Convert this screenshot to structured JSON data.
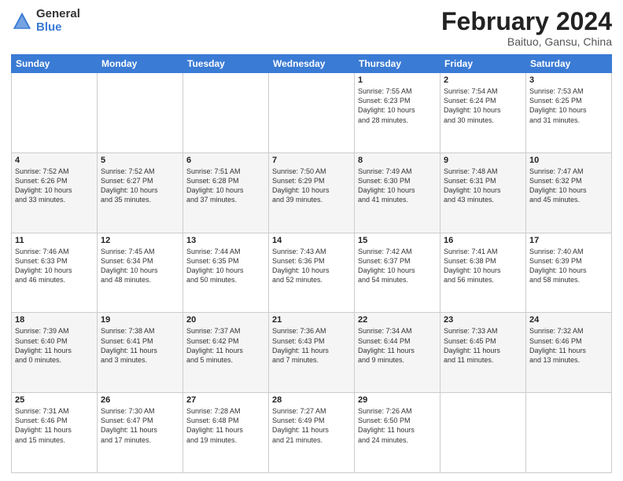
{
  "header": {
    "logo_general": "General",
    "logo_blue": "Blue",
    "title": "February 2024",
    "location": "Baituo, Gansu, China"
  },
  "days_of_week": [
    "Sunday",
    "Monday",
    "Tuesday",
    "Wednesday",
    "Thursday",
    "Friday",
    "Saturday"
  ],
  "weeks": [
    [
      {
        "day": "",
        "info": ""
      },
      {
        "day": "",
        "info": ""
      },
      {
        "day": "",
        "info": ""
      },
      {
        "day": "",
        "info": ""
      },
      {
        "day": "1",
        "info": "Sunrise: 7:55 AM\nSunset: 6:23 PM\nDaylight: 10 hours\nand 28 minutes."
      },
      {
        "day": "2",
        "info": "Sunrise: 7:54 AM\nSunset: 6:24 PM\nDaylight: 10 hours\nand 30 minutes."
      },
      {
        "day": "3",
        "info": "Sunrise: 7:53 AM\nSunset: 6:25 PM\nDaylight: 10 hours\nand 31 minutes."
      }
    ],
    [
      {
        "day": "4",
        "info": "Sunrise: 7:52 AM\nSunset: 6:26 PM\nDaylight: 10 hours\nand 33 minutes."
      },
      {
        "day": "5",
        "info": "Sunrise: 7:52 AM\nSunset: 6:27 PM\nDaylight: 10 hours\nand 35 minutes."
      },
      {
        "day": "6",
        "info": "Sunrise: 7:51 AM\nSunset: 6:28 PM\nDaylight: 10 hours\nand 37 minutes."
      },
      {
        "day": "7",
        "info": "Sunrise: 7:50 AM\nSunset: 6:29 PM\nDaylight: 10 hours\nand 39 minutes."
      },
      {
        "day": "8",
        "info": "Sunrise: 7:49 AM\nSunset: 6:30 PM\nDaylight: 10 hours\nand 41 minutes."
      },
      {
        "day": "9",
        "info": "Sunrise: 7:48 AM\nSunset: 6:31 PM\nDaylight: 10 hours\nand 43 minutes."
      },
      {
        "day": "10",
        "info": "Sunrise: 7:47 AM\nSunset: 6:32 PM\nDaylight: 10 hours\nand 45 minutes."
      }
    ],
    [
      {
        "day": "11",
        "info": "Sunrise: 7:46 AM\nSunset: 6:33 PM\nDaylight: 10 hours\nand 46 minutes."
      },
      {
        "day": "12",
        "info": "Sunrise: 7:45 AM\nSunset: 6:34 PM\nDaylight: 10 hours\nand 48 minutes."
      },
      {
        "day": "13",
        "info": "Sunrise: 7:44 AM\nSunset: 6:35 PM\nDaylight: 10 hours\nand 50 minutes."
      },
      {
        "day": "14",
        "info": "Sunrise: 7:43 AM\nSunset: 6:36 PM\nDaylight: 10 hours\nand 52 minutes."
      },
      {
        "day": "15",
        "info": "Sunrise: 7:42 AM\nSunset: 6:37 PM\nDaylight: 10 hours\nand 54 minutes."
      },
      {
        "day": "16",
        "info": "Sunrise: 7:41 AM\nSunset: 6:38 PM\nDaylight: 10 hours\nand 56 minutes."
      },
      {
        "day": "17",
        "info": "Sunrise: 7:40 AM\nSunset: 6:39 PM\nDaylight: 10 hours\nand 58 minutes."
      }
    ],
    [
      {
        "day": "18",
        "info": "Sunrise: 7:39 AM\nSunset: 6:40 PM\nDaylight: 11 hours\nand 0 minutes."
      },
      {
        "day": "19",
        "info": "Sunrise: 7:38 AM\nSunset: 6:41 PM\nDaylight: 11 hours\nand 3 minutes."
      },
      {
        "day": "20",
        "info": "Sunrise: 7:37 AM\nSunset: 6:42 PM\nDaylight: 11 hours\nand 5 minutes."
      },
      {
        "day": "21",
        "info": "Sunrise: 7:36 AM\nSunset: 6:43 PM\nDaylight: 11 hours\nand 7 minutes."
      },
      {
        "day": "22",
        "info": "Sunrise: 7:34 AM\nSunset: 6:44 PM\nDaylight: 11 hours\nand 9 minutes."
      },
      {
        "day": "23",
        "info": "Sunrise: 7:33 AM\nSunset: 6:45 PM\nDaylight: 11 hours\nand 11 minutes."
      },
      {
        "day": "24",
        "info": "Sunrise: 7:32 AM\nSunset: 6:46 PM\nDaylight: 11 hours\nand 13 minutes."
      }
    ],
    [
      {
        "day": "25",
        "info": "Sunrise: 7:31 AM\nSunset: 6:46 PM\nDaylight: 11 hours\nand 15 minutes."
      },
      {
        "day": "26",
        "info": "Sunrise: 7:30 AM\nSunset: 6:47 PM\nDaylight: 11 hours\nand 17 minutes."
      },
      {
        "day": "27",
        "info": "Sunrise: 7:28 AM\nSunset: 6:48 PM\nDaylight: 11 hours\nand 19 minutes."
      },
      {
        "day": "28",
        "info": "Sunrise: 7:27 AM\nSunset: 6:49 PM\nDaylight: 11 hours\nand 21 minutes."
      },
      {
        "day": "29",
        "info": "Sunrise: 7:26 AM\nSunset: 6:50 PM\nDaylight: 11 hours\nand 24 minutes."
      },
      {
        "day": "",
        "info": ""
      },
      {
        "day": "",
        "info": ""
      }
    ]
  ]
}
